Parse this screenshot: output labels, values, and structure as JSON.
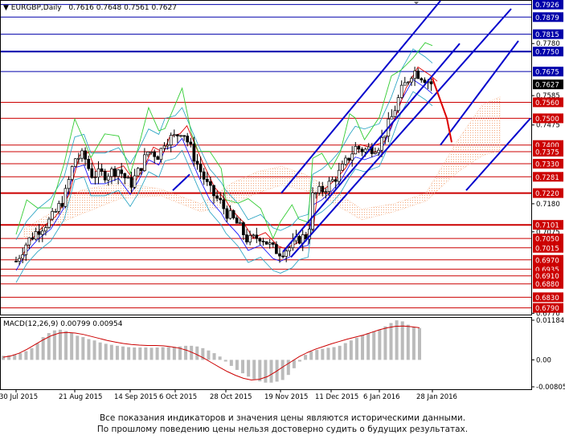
{
  "header": {
    "symbol": "EURGBP,Daily",
    "ohlc": "0.7616 0.7648 0.7561 0.7627"
  },
  "disclaimer": {
    "line1": "Все показания индикаторов и значения цены являются историческими данными.",
    "line2": "По прошлому поведению цены нельзя достоверно судить о будущих результатах."
  },
  "colors": {
    "candle": "#000000",
    "level_blue": "#0000aa",
    "level_red": "#cc0000",
    "channel": "#0000cc",
    "projection": "#dd0000",
    "bollinger": "#20a0c0",
    "envelope": "#0000ff",
    "red_ma": "#e00000",
    "momentum": "#33cc33",
    "cloud": "#f2a070",
    "macd_hist": "#bbbbbb",
    "macd_signal": "#cc0000",
    "current_price_box": "#000000",
    "blue_box": "#0000aa",
    "red_box": "#cc0000"
  },
  "chart_data": [
    {
      "type": "line",
      "title": "EURGBP,Daily",
      "y_range": [
        0.6765,
        0.794
      ],
      "x_ticks": [
        "30 Jul 2015",
        "21 Aug 2015",
        "14 Sep 2015",
        "6 Oct 2015",
        "28 Oct 2015",
        "19 Nov 2015",
        "11 Dec 2015",
        "6 Jan 2016",
        "28 Jan 2016"
      ],
      "y_ticks": [
        "0.7780",
        "0.7585",
        "0.7475",
        "0.7180",
        "0.7075",
        "0.6770"
      ],
      "series": [
        {
          "kind": "ohlc_candles",
          "close_path": [
            [
              "30 Jul 2015",
              0.6965
            ],
            [
              "3 Aug 2015",
              0.7035
            ],
            [
              "7 Aug 2015",
              0.708
            ],
            [
              "12 Aug 2015",
              0.712
            ],
            [
              "17 Aug 2015",
              0.72
            ],
            [
              "21 Aug 2015",
              0.735
            ],
            [
              "25 Aug 2015",
              0.736
            ],
            [
              "28 Aug 2015",
              0.729
            ],
            [
              "3 Sep 2015",
              0.729
            ],
            [
              "9 Sep 2015",
              0.731
            ],
            [
              "14 Sep 2015",
              0.725
            ],
            [
              "18 Sep 2015",
              0.73
            ],
            [
              "23 Sep 2015",
              0.738
            ],
            [
              "28 Sep 2015",
              0.736
            ],
            [
              "1 Oct 2015",
              0.742
            ],
            [
              "6 Oct 2015",
              0.743
            ],
            [
              "9 Oct 2015",
              0.746
            ],
            [
              "13 Oct 2015",
              0.738
            ],
            [
              "16 Oct 2015",
              0.732
            ],
            [
              "21 Oct 2015",
              0.723
            ],
            [
              "26 Oct 2015",
              0.718
            ],
            [
              "28 Oct 2015",
              0.715
            ],
            [
              "2 Nov 2015",
              0.71
            ],
            [
              "6 Nov 2015",
              0.704
            ],
            [
              "11 Nov 2015",
              0.706
            ],
            [
              "16 Nov 2015",
              0.701
            ],
            [
              "19 Nov 2015",
              0.7
            ],
            [
              "24 Nov 2015",
              0.702
            ],
            [
              "27 Nov 2015",
              0.705
            ],
            [
              "1 Dec 2015",
              0.706
            ],
            [
              "3 Dec 2015",
              0.721
            ],
            [
              "7 Dec 2015",
              0.723
            ],
            [
              "11 Dec 2015",
              0.726
            ],
            [
              "16 Dec 2015",
              0.73
            ],
            [
              "21 Dec 2015",
              0.736
            ],
            [
              "24 Dec 2015",
              0.739
            ],
            [
              "29 Dec 2015",
              0.738
            ],
            [
              "6 Jan 2016",
              0.74
            ],
            [
              "11 Jan 2016",
              0.75
            ],
            [
              "15 Jan 2016",
              0.76
            ],
            [
              "20 Jan 2016",
              0.768
            ],
            [
              "25 Jan 2016",
              0.765
            ],
            [
              "28 Jan 2016",
              0.7627
            ]
          ]
        },
        {
          "kind": "projection",
          "points": [
            [
              "28 Jan 2016",
              0.765
            ],
            [
              "3 Feb 2016",
              0.75
            ],
            [
              "5 Feb 2016",
              0.741
            ]
          ]
        }
      ],
      "price_levels": [
        {
          "value": "0.7926",
          "style": "blue"
        },
        {
          "value": "0.7879",
          "style": "blue"
        },
        {
          "value": "0.7815",
          "style": "blue"
        },
        {
          "value": "0.7750",
          "style": "blue"
        },
        {
          "value": "0.7675",
          "style": "blue"
        },
        {
          "value": "0.7627",
          "style": "current"
        },
        {
          "value": "0.7560",
          "style": "red"
        },
        {
          "value": "0.7500",
          "style": "red"
        },
        {
          "value": "0.7400",
          "style": "red"
        },
        {
          "value": "0.7375",
          "style": "red"
        },
        {
          "value": "0.7330",
          "style": "red"
        },
        {
          "value": "0.7281",
          "style": "red"
        },
        {
          "value": "0.7220",
          "style": "red"
        },
        {
          "value": "0.7101",
          "style": "red"
        },
        {
          "value": "0.7050",
          "style": "red"
        },
        {
          "value": "0.7015",
          "style": "red"
        },
        {
          "value": "0.6970",
          "style": "red"
        },
        {
          "value": "0.6935",
          "style": "red"
        },
        {
          "value": "0.6910",
          "style": "red"
        },
        {
          "value": "0.6880",
          "style": "red"
        },
        {
          "value": "0.6830",
          "style": "red"
        },
        {
          "value": "0.6790",
          "style": "red"
        }
      ]
    },
    {
      "type": "bar",
      "title": "MACD(12,26,9) 0.00799 0.00954",
      "y_range": [
        -0.00805,
        0.01184
      ],
      "y_ticks": [
        "0.01184",
        "0.00",
        "-0.00805"
      ],
      "series": [
        {
          "kind": "histogram",
          "values": [
            0.0012,
            0.0013,
            0.0016,
            0.002,
            0.0026,
            0.0035,
            0.005,
            0.0068,
            0.008,
            0.0088,
            0.009,
            0.0086,
            0.008,
            0.0072,
            0.0068,
            0.0062,
            0.0058,
            0.0052,
            0.0048,
            0.0045,
            0.0042,
            0.004,
            0.0038,
            0.0037,
            0.0037,
            0.0037,
            0.0036,
            0.0037,
            0.0038,
            0.0038,
            0.0039,
            0.004,
            0.0042,
            0.0042,
            0.004,
            0.0035,
            0.0028,
            0.002,
            0.001,
            -0.0005,
            -0.0018,
            -0.003,
            -0.004,
            -0.005,
            -0.0058,
            -0.0064,
            -0.0068,
            -0.0068,
            -0.0065,
            -0.006,
            -0.0045,
            -0.0025,
            -0.0005,
            0.0015,
            0.0025,
            0.003,
            0.0033,
            0.0036,
            0.0038,
            0.0042,
            0.005,
            0.0058,
            0.0066,
            0.0074,
            0.008,
            0.0085,
            0.009,
            0.01,
            0.011,
            0.0118,
            0.0115,
            0.0105,
            0.0098,
            0.0095
          ]
        },
        {
          "kind": "signal_line",
          "values": [
            0.0008,
            0.0012,
            0.002,
            0.0032,
            0.0046,
            0.006,
            0.0072,
            0.008,
            0.0082,
            0.008,
            0.0076,
            0.007,
            0.0064,
            0.0058,
            0.0053,
            0.0049,
            0.0046,
            0.0044,
            0.0043,
            0.0043,
            0.0042,
            0.0039,
            0.0035,
            0.0028,
            0.0018,
            0.0006,
            -0.0008,
            -0.0022,
            -0.0035,
            -0.0046,
            -0.0055,
            -0.006,
            -0.0058,
            -0.005,
            -0.0036,
            -0.002,
            -0.0005,
            0.001,
            0.0022,
            0.0032,
            0.004,
            0.0048,
            0.0055,
            0.0062,
            0.0068,
            0.0074,
            0.0082,
            0.009,
            0.0096,
            0.01,
            0.0101,
            0.0099,
            0.0096
          ]
        }
      ]
    }
  ]
}
